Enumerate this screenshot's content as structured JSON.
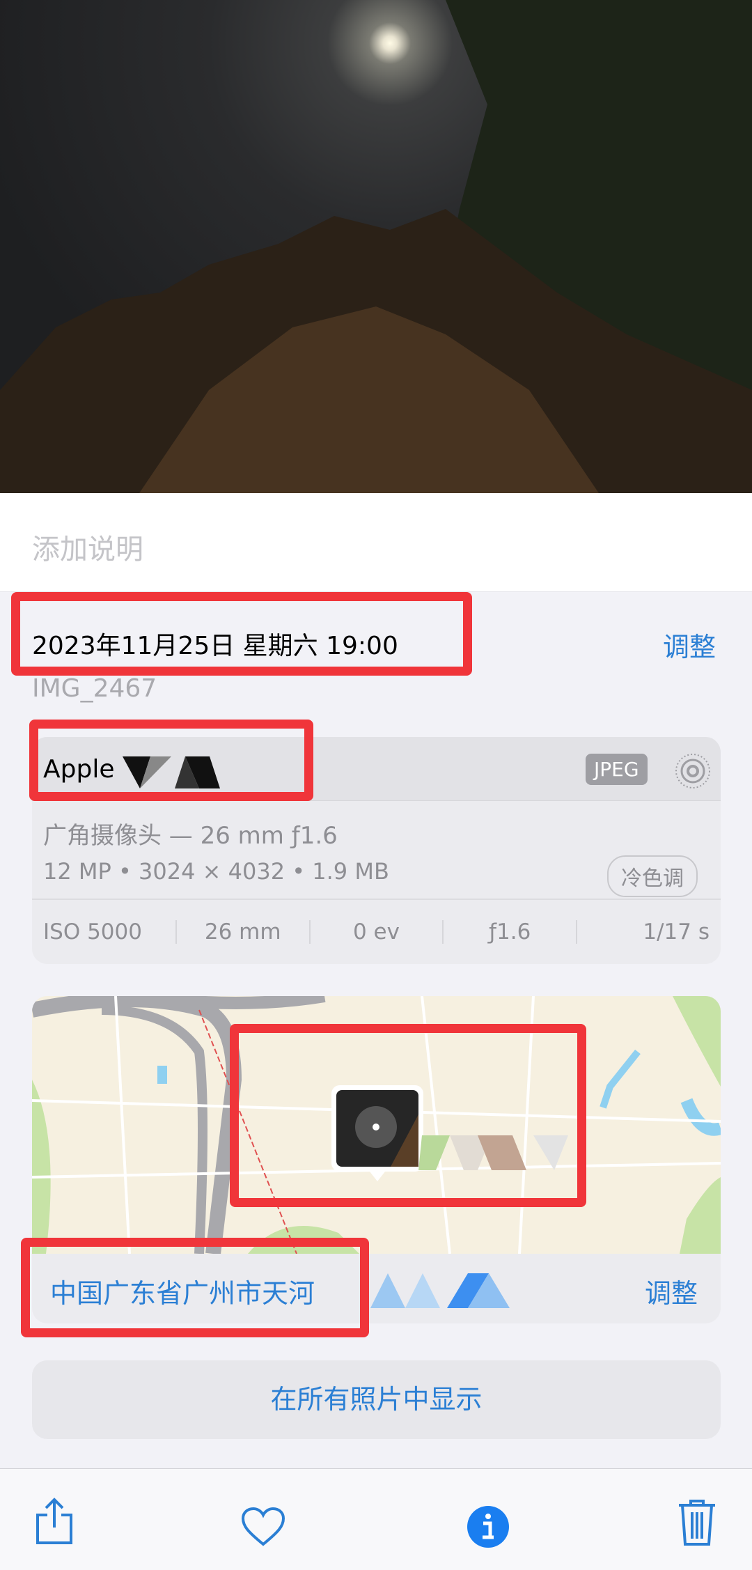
{
  "caption_placeholder": "添加说明",
  "datetime": "2023年11月25日 星期六 19:00",
  "adjust_label": "调整",
  "filename": "IMG_2467",
  "camera": {
    "device": "Apple",
    "format_badge": "JPEG",
    "lens": "广角摄像头 — 26 mm ƒ1.6",
    "specs": "12 MP • 3024 × 4032 • 1.9 MB",
    "style_pill": "冷色调",
    "exif": [
      "ISO 5000",
      "26 mm",
      "0 ev",
      "ƒ1.6",
      "1/17 s"
    ]
  },
  "location": {
    "text": "中国广东省广州市天河",
    "adjust_label": "调整"
  },
  "show_all_label": "在所有照片中显示",
  "toolbar": {
    "icons": [
      "share-icon",
      "heart-icon",
      "info-icon",
      "trash-icon"
    ]
  },
  "colors": {
    "accent": "#2b7fd4",
    "highlight": "#f0353a"
  }
}
